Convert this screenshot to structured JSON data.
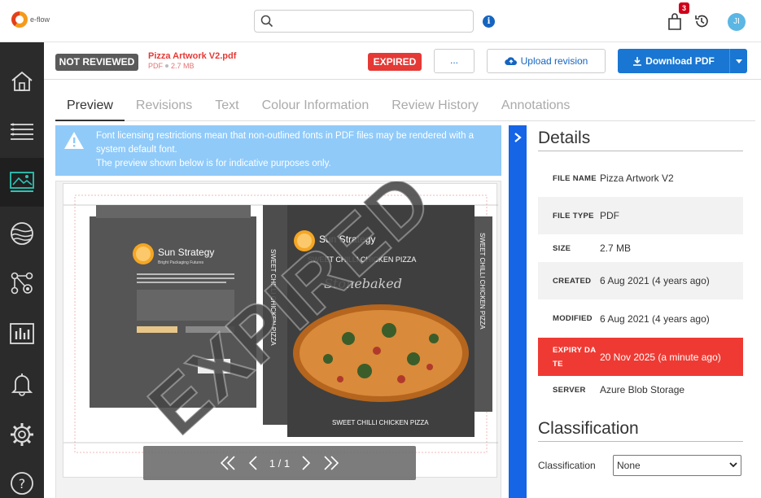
{
  "app": {
    "logo_text": "e-flow"
  },
  "header": {
    "search_placeholder": "",
    "cart_count": "3",
    "avatar_initials": "JI"
  },
  "sidebar": {
    "items": [
      "home-icon",
      "list-icon",
      "image-gallery-icon",
      "globe-icon",
      "network-icon",
      "reports-icon",
      "bell-icon",
      "settings-icon",
      "help-icon"
    ],
    "active_index": 2
  },
  "document": {
    "review_status": "NOT REVIEWED",
    "file_name": "Pizza Artwork V2.pdf",
    "file_type": "PDF",
    "file_size": "2.7 MB",
    "expired_label": "EXPIRED",
    "more_label": "...",
    "upload_label": "Upload revision",
    "download_label": "Download PDF"
  },
  "tabs": [
    "Preview",
    "Revisions",
    "Text",
    "Colour Information",
    "Review History",
    "Annotations"
  ],
  "active_tab": 0,
  "notice": {
    "line1": "Font licensing restrictions mean that non-outlined fonts in PDF files may be rendered with a system default font.",
    "line2": "The preview shown below is for indicative purposes only."
  },
  "preview": {
    "watermark": "EXPIRED",
    "page_indicator": "1 / 1",
    "artwork": {
      "brand": "Sun Strategy",
      "tagline": "Bright Packaging Futures",
      "product": "SWEET CHILLI CHICKEN PIZZA",
      "script_brand": "Stonebaked"
    }
  },
  "details": {
    "title": "Details",
    "rows": [
      {
        "label": "FILE NAME",
        "value": "Pizza Artwork V2"
      },
      {
        "label": "FILE TYPE",
        "value": "PDF"
      },
      {
        "label": "SIZE",
        "value": "2.7 MB"
      },
      {
        "label": "CREATED",
        "value": "6 Aug 2021 (4 years ago)"
      },
      {
        "label": "MODIFIED",
        "value": "6 Aug 2021 (4 years ago)"
      },
      {
        "label": "EXPIRY DATE",
        "value": "20 Nov 2025 (a minute ago)"
      },
      {
        "label": "SERVER",
        "value": "Azure Blob Storage"
      }
    ]
  },
  "classification": {
    "title": "Classification",
    "label": "Classification",
    "selected": "None"
  },
  "colors": {
    "accent_blue": "#1976d2",
    "expired_red": "#ef3a33",
    "sidebar_bg": "#2b2b2b",
    "notice_bg": "#90caf9"
  }
}
